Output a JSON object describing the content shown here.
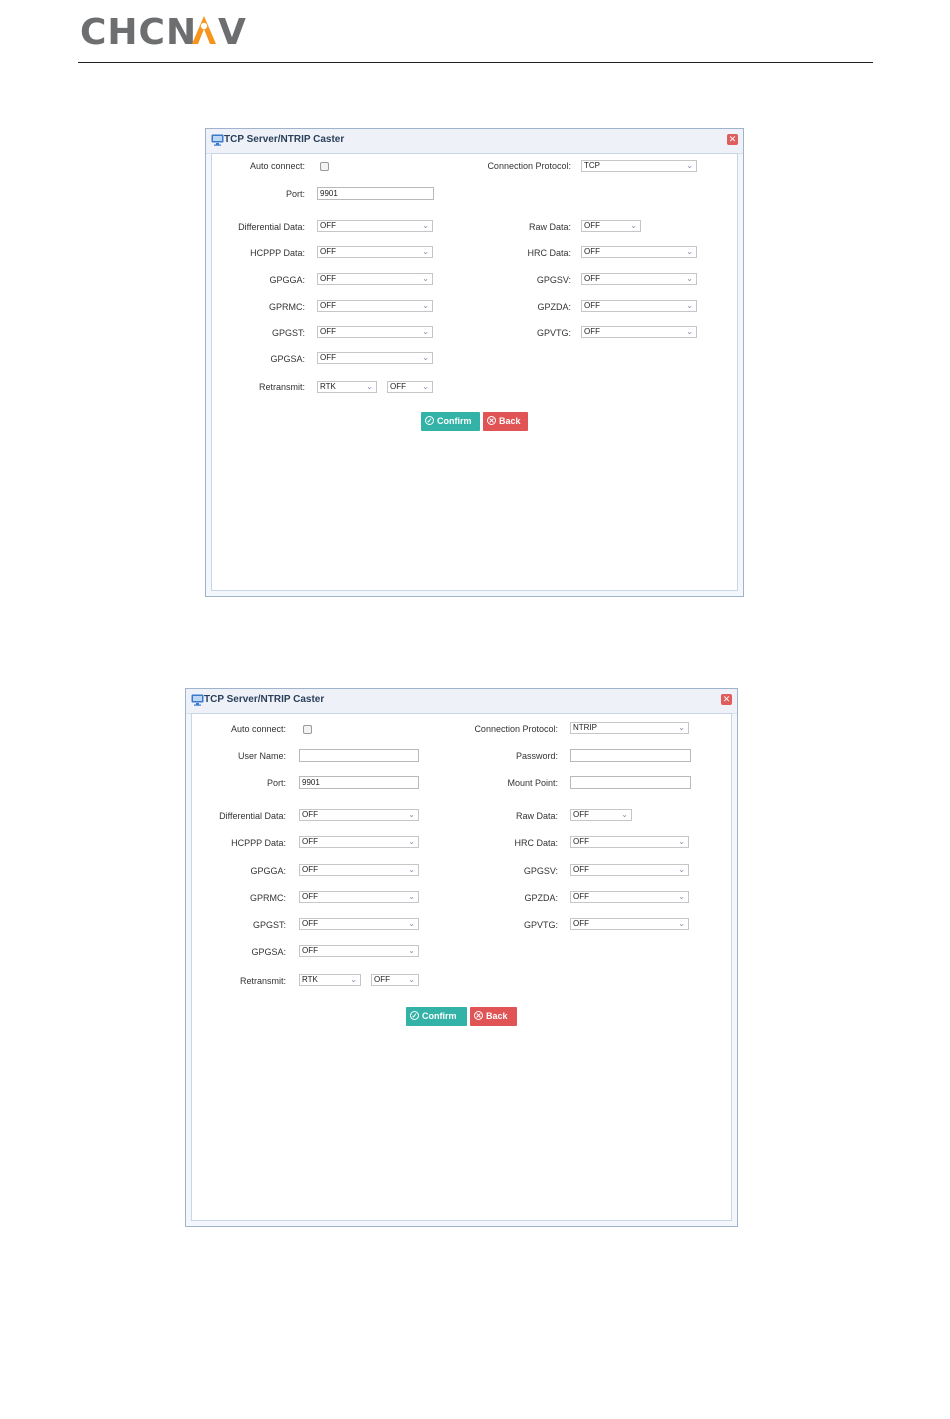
{
  "logo": {
    "text": "CHCNAV",
    "colors": {
      "text": "#6d6e70",
      "accent": "#f7941d"
    }
  },
  "dialogs": [
    {
      "title": "TCP Server/NTRIP Caster",
      "close_icon": "close-icon",
      "auto_connect_label": "Auto connect:",
      "protocol_label": "Connection Protocol:",
      "protocol_value": "TCP",
      "port_label": "Port:",
      "port_value": "9901",
      "differential_label": "Differential Data:",
      "differential_value": "OFF",
      "raw_label": "Raw Data:",
      "raw_value": "OFF",
      "hcppp_label": "HCPPP Data:",
      "hcppp_value": "OFF",
      "hrc_label": "HRC Data:",
      "hrc_value": "OFF",
      "gpgga_label": "GPGGA:",
      "gpgga_value": "OFF",
      "gpgsv_label": "GPGSV:",
      "gpgsv_value": "OFF",
      "gprmc_label": "GPRMC:",
      "gprmc_value": "OFF",
      "gpzda_label": "GPZDA:",
      "gpzda_value": "OFF",
      "gpgst_label": "GPGST:",
      "gpgst_value": "OFF",
      "gpvtg_label": "GPVTG:",
      "gpvtg_value": "OFF",
      "gpgsa_label": "GPGSA:",
      "gpgsa_value": "OFF",
      "retransmit_label": "Retransmit:",
      "retransmit_value1": "RTK",
      "retransmit_value2": "OFF",
      "confirm_label": "Confirm",
      "back_label": "Back"
    },
    {
      "title": "TCP Server/NTRIP Caster",
      "close_icon": "close-icon",
      "auto_connect_label": "Auto connect:",
      "protocol_label": "Connection Protocol:",
      "protocol_value": "NTRIP",
      "username_label": "User Name:",
      "username_value": "",
      "password_label": "Password:",
      "password_value": "",
      "port_label": "Port:",
      "port_value": "9901",
      "mountpoint_label": "Mount Point:",
      "mountpoint_value": "",
      "differential_label": "Differential Data:",
      "differential_value": "OFF",
      "raw_label": "Raw Data:",
      "raw_value": "OFF",
      "hcppp_label": "HCPPP Data:",
      "hcppp_value": "OFF",
      "hrc_label": "HRC Data:",
      "hrc_value": "OFF",
      "gpgga_label": "GPGGA:",
      "gpgga_value": "OFF",
      "gpgsv_label": "GPGSV:",
      "gpgsv_value": "OFF",
      "gprmc_label": "GPRMC:",
      "gprmc_value": "OFF",
      "gpzda_label": "GPZDA:",
      "gpzda_value": "OFF",
      "gpgst_label": "GPGST:",
      "gpgst_value": "OFF",
      "gpvtg_label": "GPVTG:",
      "gpvtg_value": "OFF",
      "gpgsa_label": "GPGSA:",
      "gpgsa_value": "OFF",
      "retransmit_label": "Retransmit:",
      "retransmit_value1": "RTK",
      "retransmit_value2": "OFF",
      "confirm_label": "Confirm",
      "back_label": "Back"
    }
  ]
}
